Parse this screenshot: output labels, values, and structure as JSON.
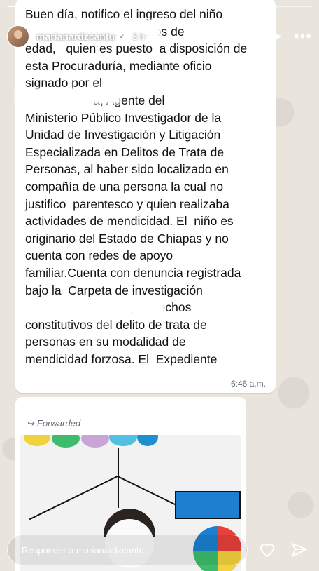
{
  "story": {
    "progress_segments": 5,
    "progress_done": 1
  },
  "header": {
    "username": "marianardzcantu",
    "verified": true,
    "time": "3 h",
    "icons": [
      "play-icon",
      "more-icon"
    ]
  },
  "chat": {
    "message_lines": [
      "Buen día, notifico el ingreso del niño",
      "                          de    años de",
      "edad,   quien es puesto  a disposición de",
      "esta Procuraduría, mediante oficio",
      "signado por el",
      "                    a, Agente del",
      "Ministerio Público Investigador de la",
      "Unidad de Investigación y Litigación",
      "Especializada en Delitos de Trata de",
      "Personas, al haber sido localizado en",
      "compañía de una persona la cual no",
      "justifico  parentesco y quien realizaba",
      "actividades de mendicidad. El  niño es",
      "originario del Estado de Chiapas y no",
      "cuenta con redes de apoyo",
      "familiar.Cuenta con denuncia registrada",
      "bajo la  Carpeta de investigación",
      "                               por hechos",
      "constitutivos del delito de trata de",
      "personas en su modalidad de",
      "mendicidad forzosa. El  Expediente"
    ],
    "message_time": "6:46 a.m.",
    "forwarded_label": "Forwarded"
  },
  "footer": {
    "reply_placeholder": "Responder a marianardzcantu...",
    "icons": [
      "heart-icon",
      "send-icon"
    ]
  }
}
